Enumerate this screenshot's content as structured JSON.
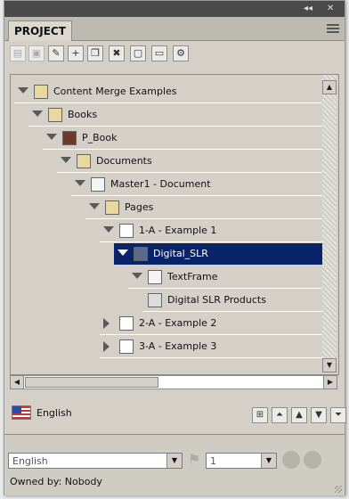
{
  "panel": {
    "tab_label": "PROJECT",
    "collapse_glyph": "◂◂",
    "close_glyph": "✕"
  },
  "toolbar": {
    "icons": [
      "page-icon",
      "save-icon",
      "edit-icon",
      "add-icon",
      "copy-icon",
      "delete-icon",
      "frame-icon",
      "image-icon",
      "settings-icon"
    ]
  },
  "tree": {
    "nodes": [
      {
        "label": "Content Merge Examples",
        "icon": "folder-icon",
        "caret": "open"
      },
      {
        "label": "Books",
        "icon": "folder-icon",
        "caret": "open"
      },
      {
        "label": "P_Book",
        "icon": "book-icon",
        "caret": "open"
      },
      {
        "label": "Documents",
        "icon": "folder-icon",
        "caret": "open"
      },
      {
        "label": "Master1 - Document",
        "icon": "document-icon",
        "caret": "open"
      },
      {
        "label": "Pages",
        "icon": "folder-icon",
        "caret": "open"
      },
      {
        "label": "1-A - Example 1",
        "icon": "page-icon",
        "caret": "open"
      },
      {
        "label": "Digital_SLR",
        "icon": "component-icon",
        "caret": "open",
        "selected": true
      },
      {
        "label": "TextFrame",
        "icon": "textframe-icon",
        "caret": "open"
      },
      {
        "label": "Digital SLR Products",
        "icon": "text-content-icon",
        "caret": "none"
      },
      {
        "label": "2-A - Example 2",
        "icon": "page-icon",
        "caret": "closed"
      },
      {
        "label": "3-A - Example 3",
        "icon": "page-icon",
        "caret": "closed"
      }
    ]
  },
  "language": {
    "label": "English",
    "flag": "us-flag-icon"
  },
  "bottom": {
    "language_select": "English",
    "page_select": "1",
    "owned_by": "Owned by: Nobody"
  },
  "colors": {
    "selection": "#0a246a",
    "panel": "#d4d0c8"
  }
}
